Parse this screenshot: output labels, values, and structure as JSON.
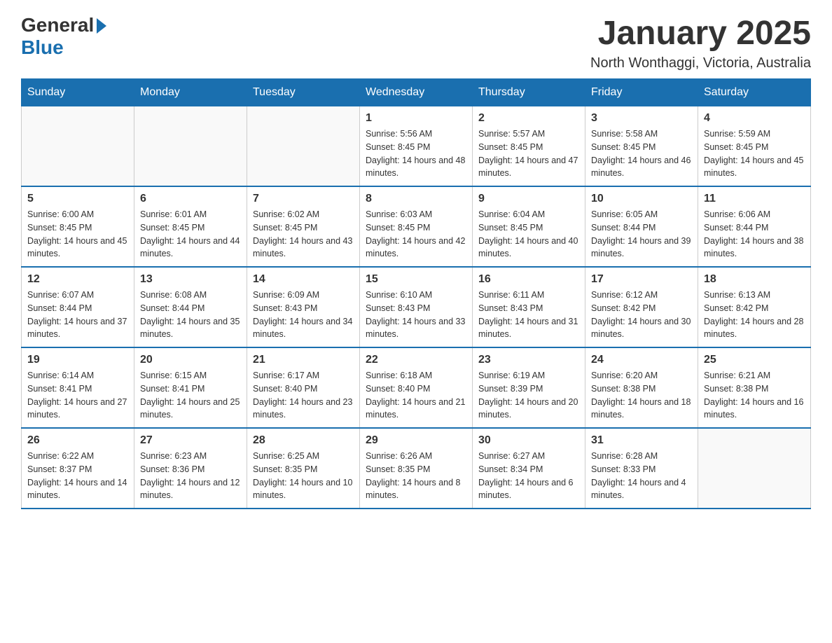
{
  "header": {
    "logo_general": "General",
    "logo_blue": "Blue",
    "month_title": "January 2025",
    "location": "North Wonthaggi, Victoria, Australia"
  },
  "days_of_week": [
    "Sunday",
    "Monday",
    "Tuesday",
    "Wednesday",
    "Thursday",
    "Friday",
    "Saturday"
  ],
  "weeks": [
    [
      {
        "day": "",
        "info": ""
      },
      {
        "day": "",
        "info": ""
      },
      {
        "day": "",
        "info": ""
      },
      {
        "day": "1",
        "info": "Sunrise: 5:56 AM\nSunset: 8:45 PM\nDaylight: 14 hours and 48 minutes."
      },
      {
        "day": "2",
        "info": "Sunrise: 5:57 AM\nSunset: 8:45 PM\nDaylight: 14 hours and 47 minutes."
      },
      {
        "day": "3",
        "info": "Sunrise: 5:58 AM\nSunset: 8:45 PM\nDaylight: 14 hours and 46 minutes."
      },
      {
        "day": "4",
        "info": "Sunrise: 5:59 AM\nSunset: 8:45 PM\nDaylight: 14 hours and 45 minutes."
      }
    ],
    [
      {
        "day": "5",
        "info": "Sunrise: 6:00 AM\nSunset: 8:45 PM\nDaylight: 14 hours and 45 minutes."
      },
      {
        "day": "6",
        "info": "Sunrise: 6:01 AM\nSunset: 8:45 PM\nDaylight: 14 hours and 44 minutes."
      },
      {
        "day": "7",
        "info": "Sunrise: 6:02 AM\nSunset: 8:45 PM\nDaylight: 14 hours and 43 minutes."
      },
      {
        "day": "8",
        "info": "Sunrise: 6:03 AM\nSunset: 8:45 PM\nDaylight: 14 hours and 42 minutes."
      },
      {
        "day": "9",
        "info": "Sunrise: 6:04 AM\nSunset: 8:45 PM\nDaylight: 14 hours and 40 minutes."
      },
      {
        "day": "10",
        "info": "Sunrise: 6:05 AM\nSunset: 8:44 PM\nDaylight: 14 hours and 39 minutes."
      },
      {
        "day": "11",
        "info": "Sunrise: 6:06 AM\nSunset: 8:44 PM\nDaylight: 14 hours and 38 minutes."
      }
    ],
    [
      {
        "day": "12",
        "info": "Sunrise: 6:07 AM\nSunset: 8:44 PM\nDaylight: 14 hours and 37 minutes."
      },
      {
        "day": "13",
        "info": "Sunrise: 6:08 AM\nSunset: 8:44 PM\nDaylight: 14 hours and 35 minutes."
      },
      {
        "day": "14",
        "info": "Sunrise: 6:09 AM\nSunset: 8:43 PM\nDaylight: 14 hours and 34 minutes."
      },
      {
        "day": "15",
        "info": "Sunrise: 6:10 AM\nSunset: 8:43 PM\nDaylight: 14 hours and 33 minutes."
      },
      {
        "day": "16",
        "info": "Sunrise: 6:11 AM\nSunset: 8:43 PM\nDaylight: 14 hours and 31 minutes."
      },
      {
        "day": "17",
        "info": "Sunrise: 6:12 AM\nSunset: 8:42 PM\nDaylight: 14 hours and 30 minutes."
      },
      {
        "day": "18",
        "info": "Sunrise: 6:13 AM\nSunset: 8:42 PM\nDaylight: 14 hours and 28 minutes."
      }
    ],
    [
      {
        "day": "19",
        "info": "Sunrise: 6:14 AM\nSunset: 8:41 PM\nDaylight: 14 hours and 27 minutes."
      },
      {
        "day": "20",
        "info": "Sunrise: 6:15 AM\nSunset: 8:41 PM\nDaylight: 14 hours and 25 minutes."
      },
      {
        "day": "21",
        "info": "Sunrise: 6:17 AM\nSunset: 8:40 PM\nDaylight: 14 hours and 23 minutes."
      },
      {
        "day": "22",
        "info": "Sunrise: 6:18 AM\nSunset: 8:40 PM\nDaylight: 14 hours and 21 minutes."
      },
      {
        "day": "23",
        "info": "Sunrise: 6:19 AM\nSunset: 8:39 PM\nDaylight: 14 hours and 20 minutes."
      },
      {
        "day": "24",
        "info": "Sunrise: 6:20 AM\nSunset: 8:38 PM\nDaylight: 14 hours and 18 minutes."
      },
      {
        "day": "25",
        "info": "Sunrise: 6:21 AM\nSunset: 8:38 PM\nDaylight: 14 hours and 16 minutes."
      }
    ],
    [
      {
        "day": "26",
        "info": "Sunrise: 6:22 AM\nSunset: 8:37 PM\nDaylight: 14 hours and 14 minutes."
      },
      {
        "day": "27",
        "info": "Sunrise: 6:23 AM\nSunset: 8:36 PM\nDaylight: 14 hours and 12 minutes."
      },
      {
        "day": "28",
        "info": "Sunrise: 6:25 AM\nSunset: 8:35 PM\nDaylight: 14 hours and 10 minutes."
      },
      {
        "day": "29",
        "info": "Sunrise: 6:26 AM\nSunset: 8:35 PM\nDaylight: 14 hours and 8 minutes."
      },
      {
        "day": "30",
        "info": "Sunrise: 6:27 AM\nSunset: 8:34 PM\nDaylight: 14 hours and 6 minutes."
      },
      {
        "day": "31",
        "info": "Sunrise: 6:28 AM\nSunset: 8:33 PM\nDaylight: 14 hours and 4 minutes."
      },
      {
        "day": "",
        "info": ""
      }
    ]
  ]
}
